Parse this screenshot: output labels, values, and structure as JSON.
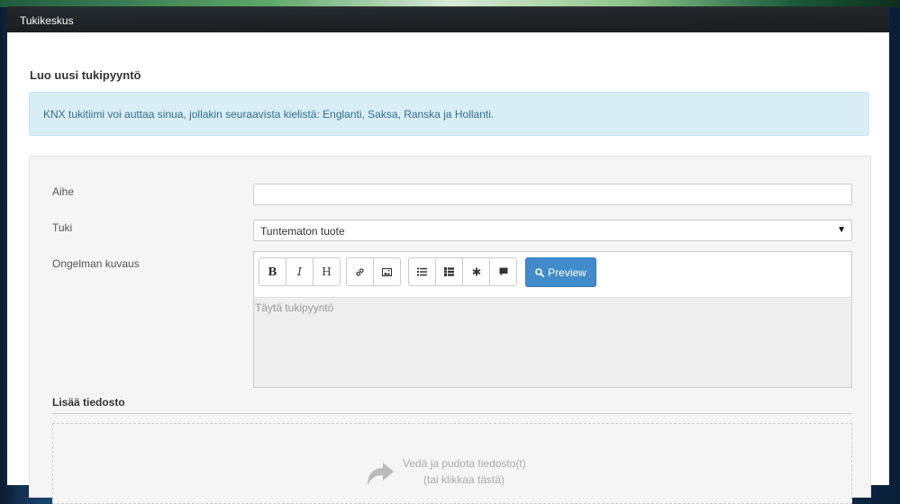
{
  "navbar": {
    "brand": "Tukikeskus"
  },
  "page": {
    "title": "Luo uusi tukipyyntö",
    "info_alert": "KNX tukitiimi voi auttaa sinua, jollakin seuraavista kielistä: Englanti, Saksa, Ranska ja Hollanti."
  },
  "form": {
    "subject": {
      "label": "Aihe",
      "value": ""
    },
    "support": {
      "label": "Tuki",
      "selected": "Tuntematon tuote"
    },
    "description": {
      "label": "Ongelman kuvaus",
      "placeholder": "Täytä tukipyyntö",
      "toolbar": {
        "bold": "B",
        "italic": "I",
        "heading": "H",
        "icons": [
          "link-icon",
          "image-icon",
          "bullet-list-icon",
          "numbered-list-icon",
          "asterisk-icon",
          "comment-icon"
        ],
        "preview_label": "Preview"
      }
    },
    "attachments": {
      "title": "Lisää tiedosto",
      "drop_text": "Vedä ja pudota tiedosto(t)",
      "click_text": "(tai klikkaa tästä)"
    }
  },
  "colors": {
    "primary": "#428bca",
    "alert_bg": "#d9edf7",
    "alert_text": "#31708f",
    "navbar_bg": "#222222"
  }
}
